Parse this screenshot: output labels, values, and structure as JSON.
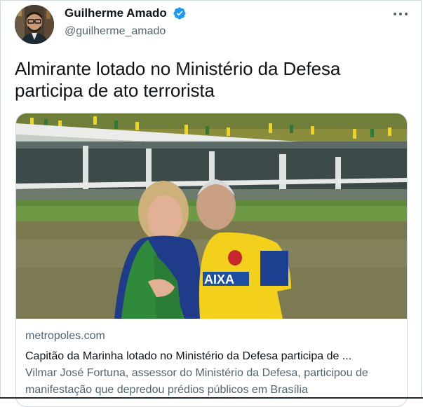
{
  "author": {
    "display_name": "Guilherme Amado",
    "handle": "@guilherme_amado",
    "verified": true
  },
  "tweet": {
    "text": "Almirante lotado no Ministério da Defesa participa de ato terrorista"
  },
  "link_card": {
    "domain": "metropoles.com",
    "title": "Capitão da Marinha lotado no Ministério da Defesa participa de ...",
    "description": "Vilmar José Fortuna, assessor do Ministério da Defesa, participou de manifestação que depredou prédios públicos em Brasília"
  },
  "icons": {
    "verified": "verified-badge-icon",
    "more": "more-options-icon"
  },
  "colors": {
    "verified_blue": "#1d9bf0",
    "secondary_text": "#536471",
    "border": "#cfd9de"
  }
}
